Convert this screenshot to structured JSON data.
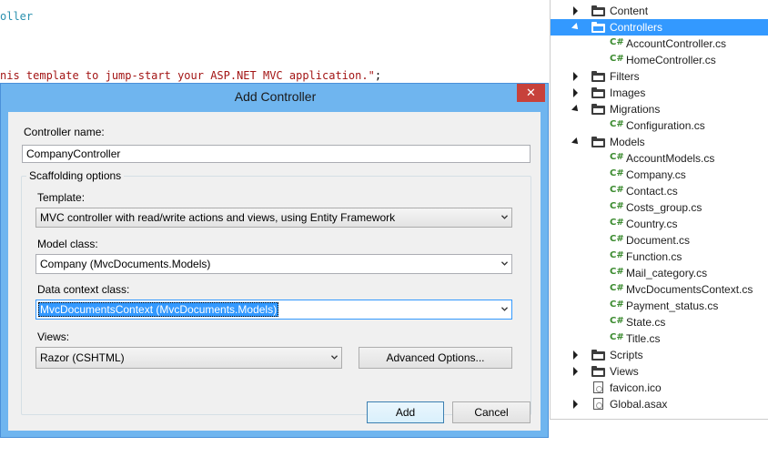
{
  "editor": {
    "line1": "oller",
    "line2_text": "nis template to jump-start your ASP.NET MVC application.\"",
    "line2_punct": ";"
  },
  "solution_explorer": {
    "items": [
      {
        "label": "Content",
        "type": "folder",
        "expanded": false,
        "selected": false,
        "depth": 0
      },
      {
        "label": "Controllers",
        "type": "folder",
        "expanded": true,
        "selected": true,
        "depth": 0
      },
      {
        "label": "AccountController.cs",
        "type": "cs",
        "depth": 1
      },
      {
        "label": "HomeController.cs",
        "type": "cs",
        "depth": 1
      },
      {
        "label": "Filters",
        "type": "folder",
        "expanded": false,
        "depth": 0
      },
      {
        "label": "Images",
        "type": "folder",
        "expanded": false,
        "depth": 0
      },
      {
        "label": "Migrations",
        "type": "folder",
        "expanded": true,
        "depth": 0
      },
      {
        "label": "Configuration.cs",
        "type": "cs",
        "depth": 1
      },
      {
        "label": "Models",
        "type": "folder",
        "expanded": true,
        "depth": 0
      },
      {
        "label": "AccountModels.cs",
        "type": "cs",
        "depth": 1
      },
      {
        "label": "Company.cs",
        "type": "cs",
        "depth": 1
      },
      {
        "label": "Contact.cs",
        "type": "cs",
        "depth": 1
      },
      {
        "label": "Costs_group.cs",
        "type": "cs",
        "depth": 1
      },
      {
        "label": "Country.cs",
        "type": "cs",
        "depth": 1
      },
      {
        "label": "Document.cs",
        "type": "cs",
        "depth": 1
      },
      {
        "label": "Function.cs",
        "type": "cs",
        "depth": 1
      },
      {
        "label": "Mail_category.cs",
        "type": "cs",
        "depth": 1
      },
      {
        "label": "MvcDocumentsContext.cs",
        "type": "cs",
        "depth": 1
      },
      {
        "label": "Payment_status.cs",
        "type": "cs",
        "depth": 1
      },
      {
        "label": "State.cs",
        "type": "cs",
        "depth": 1
      },
      {
        "label": "Title.cs",
        "type": "cs",
        "depth": 1
      },
      {
        "label": "Scripts",
        "type": "folder",
        "expanded": false,
        "depth": 0
      },
      {
        "label": "Views",
        "type": "folder",
        "expanded": false,
        "depth": 0
      },
      {
        "label": "favicon.ico",
        "type": "file",
        "depth": 0
      },
      {
        "label": "Global.asax",
        "type": "file-arrow",
        "depth": 0
      }
    ],
    "cs_icon_text": "C#"
  },
  "dialog": {
    "title": "Add Controller",
    "close_glyph": "✕",
    "controller_name_label": "Controller name:",
    "controller_name_value": "CompanyController",
    "scaffolding_label": "Scaffolding options",
    "template_label": "Template:",
    "template_value": "MVC controller with read/write actions and views, using Entity Framework",
    "model_class_label": "Model class:",
    "model_class_value": "Company (MvcDocuments.Models)",
    "data_context_label": "Data context class:",
    "data_context_value": "MvcDocumentsContext (MvcDocuments.Models)",
    "views_label": "Views:",
    "views_value": "Razor (CSHTML)",
    "advanced_button": "Advanced Options...",
    "add_button": "Add",
    "cancel_button": "Cancel"
  },
  "colors": {
    "selection": "#3399ff",
    "dialog_frame": "#6fb5ef",
    "close_button": "#c7413b",
    "cs_icon": "#3a8a2e"
  }
}
